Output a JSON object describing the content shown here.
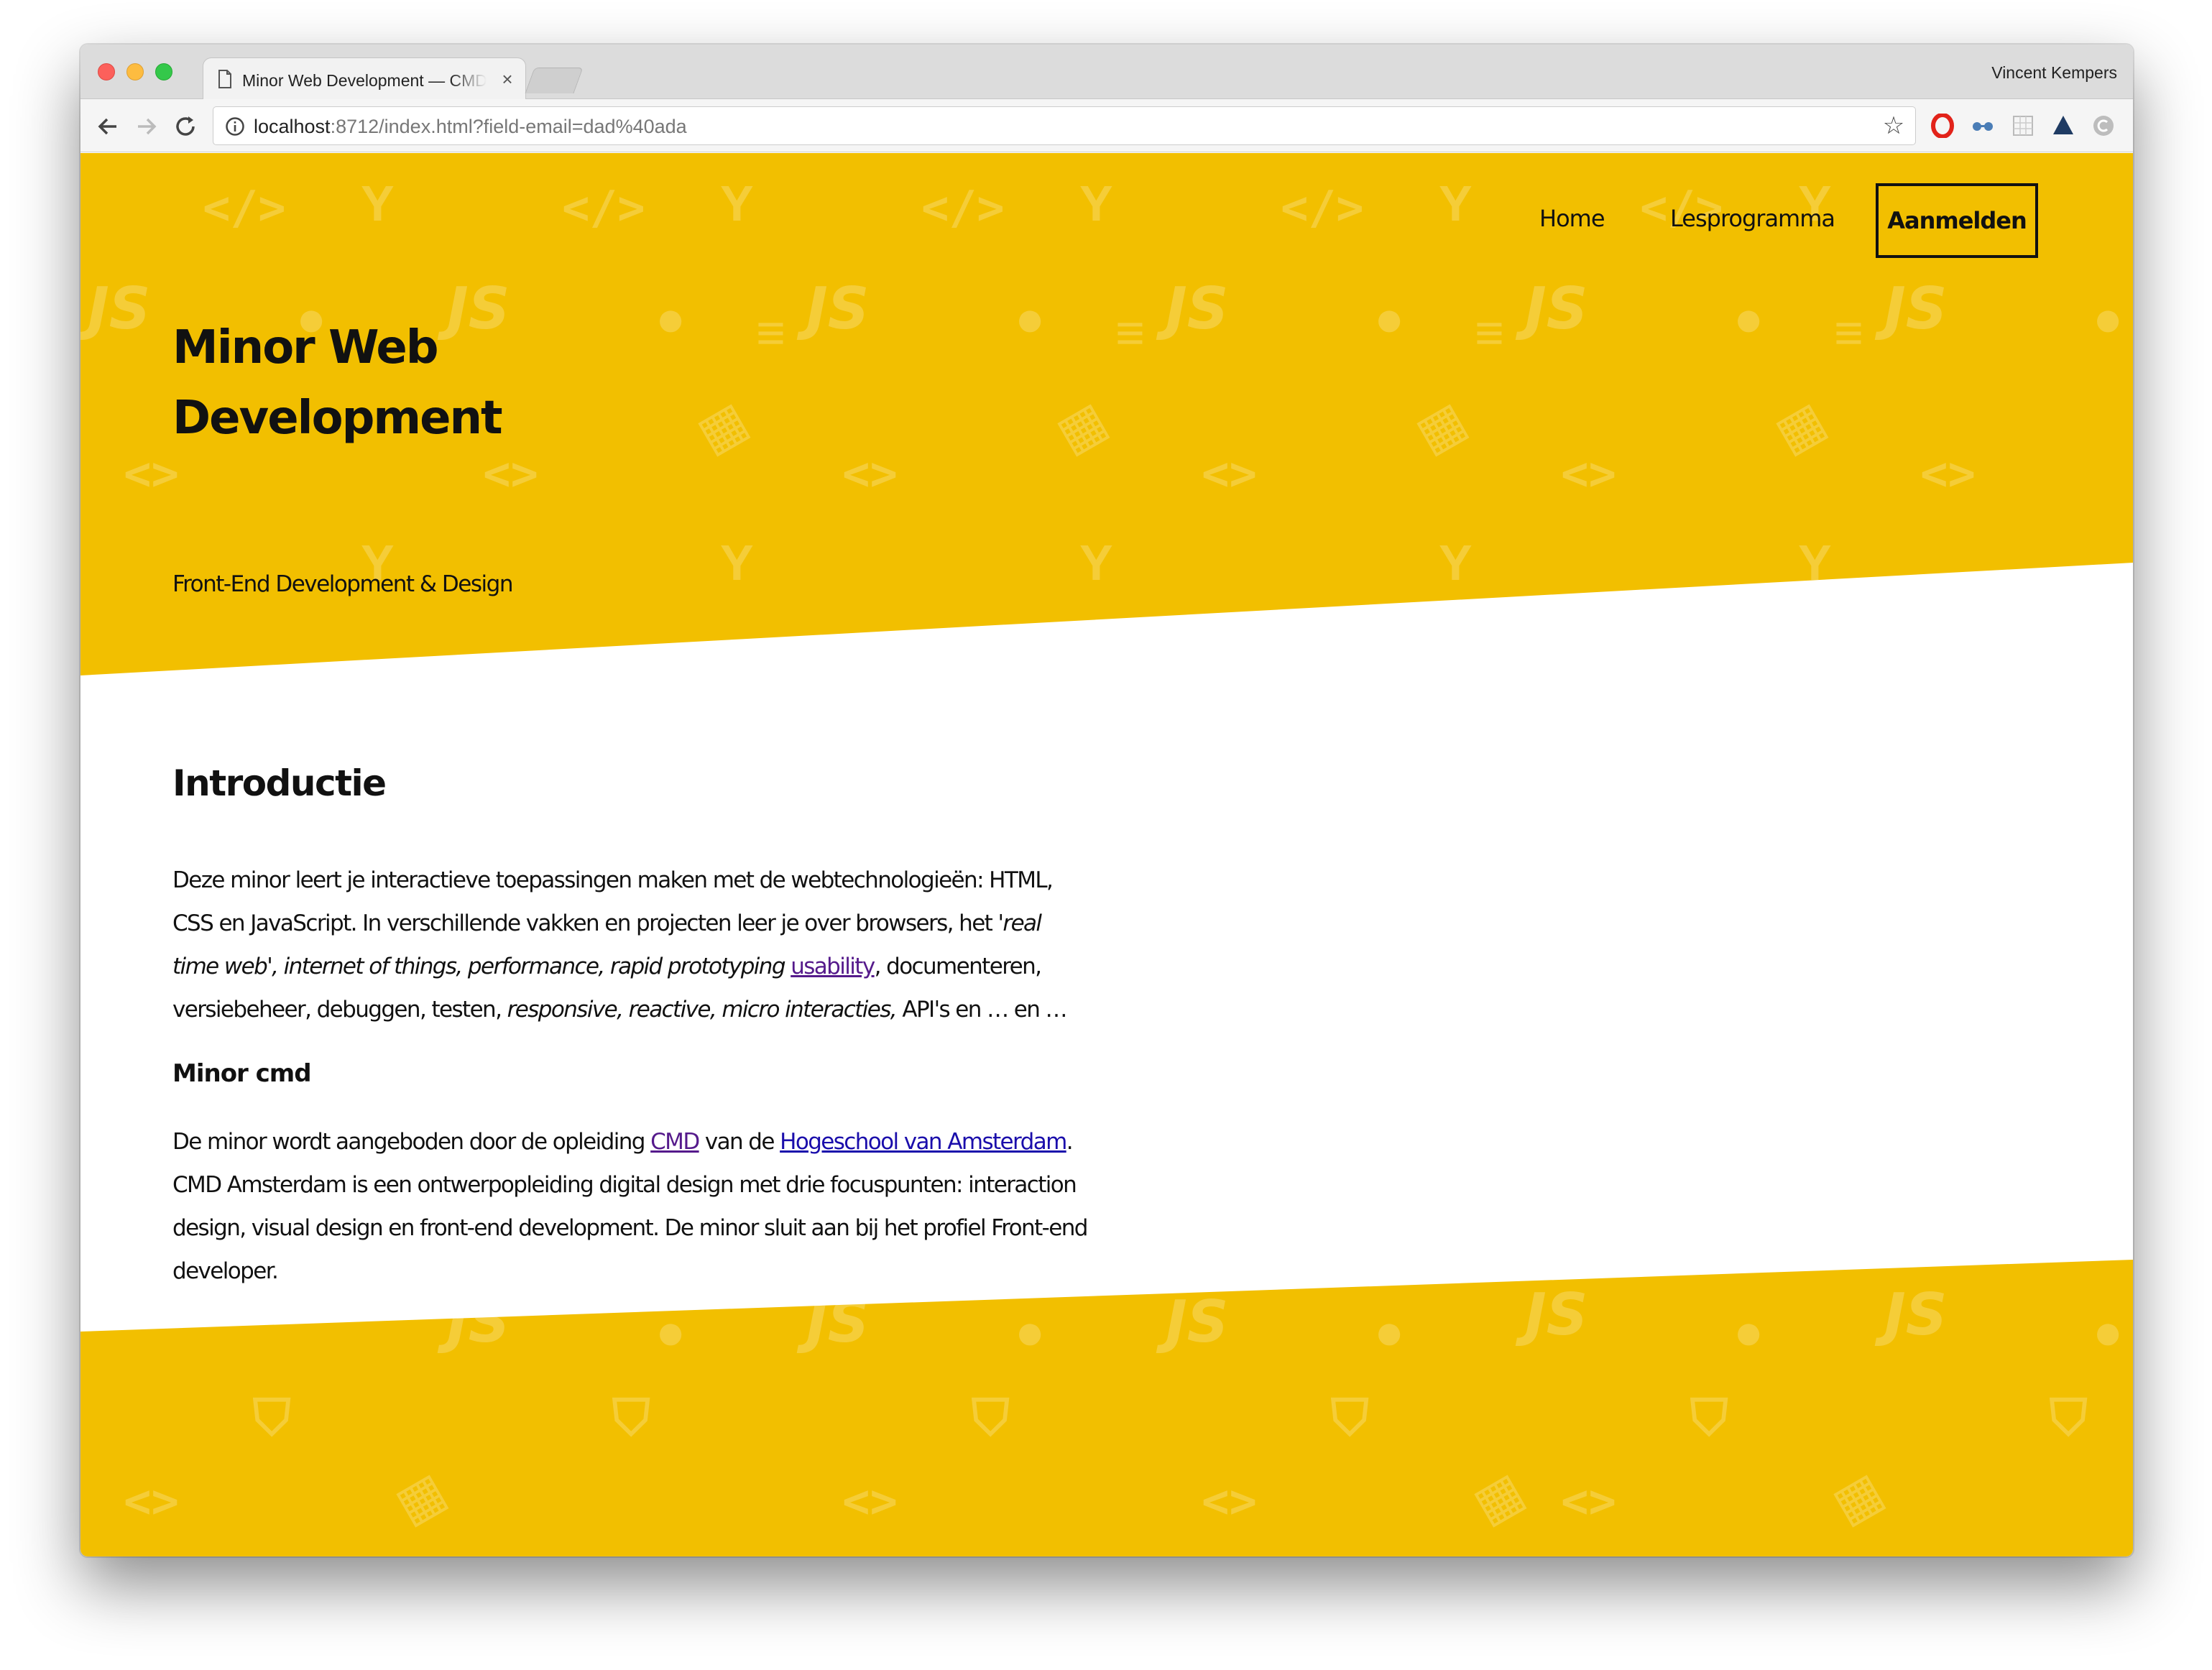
{
  "browser": {
    "tab_title": "Minor Web Development — CMD",
    "tab_close": "×",
    "profile_name": "Vincent Kempers",
    "url_host": "localhost",
    "url_rest": ":8712/index.html?field-email=dad%40ada",
    "icons": [
      "back-icon",
      "forward-icon",
      "reload-icon",
      "info-icon",
      "star-icon"
    ]
  },
  "nav": {
    "home": "Home",
    "program": "Lesprogramma",
    "signup": "Aanmelden"
  },
  "hero": {
    "title_line1": "Minor Web",
    "title_line2": "Development",
    "subtitle": "Front-End Development & Design"
  },
  "intro": {
    "heading": "Introductie",
    "p1_a": "Deze minor leert je interactieve toepassingen maken met de webtechnologieën: HTML, CSS en JavaScript. In verschillende vakken en projecten leer je over browsers, het ",
    "p1_em1": "'real time web',",
    "p1_em2": "internet of things, performance, rapid prototyping",
    "p1_link": "usability",
    "p1_b": ", documenteren, versiebeheer, debuggen, testen, ",
    "p1_em3": "responsive, reactive, micro interacties,",
    "p1_c": " API's en … en …"
  },
  "cmd": {
    "heading": "Minor cmd",
    "p_a": "De minor wordt aangeboden door de opleiding ",
    "link_cmd": "CMD",
    "p_b": " van de ",
    "link_hva": "Hogeschool van Amsterdam",
    "p_c": ". CMD Amsterdam is een ontwerpopleiding digital design met drie focuspunten: interaction design, visual design en front-end development. De minor sluit aan bij het profiel Front-end developer."
  },
  "colors": {
    "brand_yellow": "#f2bf00",
    "text": "#111111",
    "link": "#1a0dab",
    "visited_link": "#551a8b"
  }
}
